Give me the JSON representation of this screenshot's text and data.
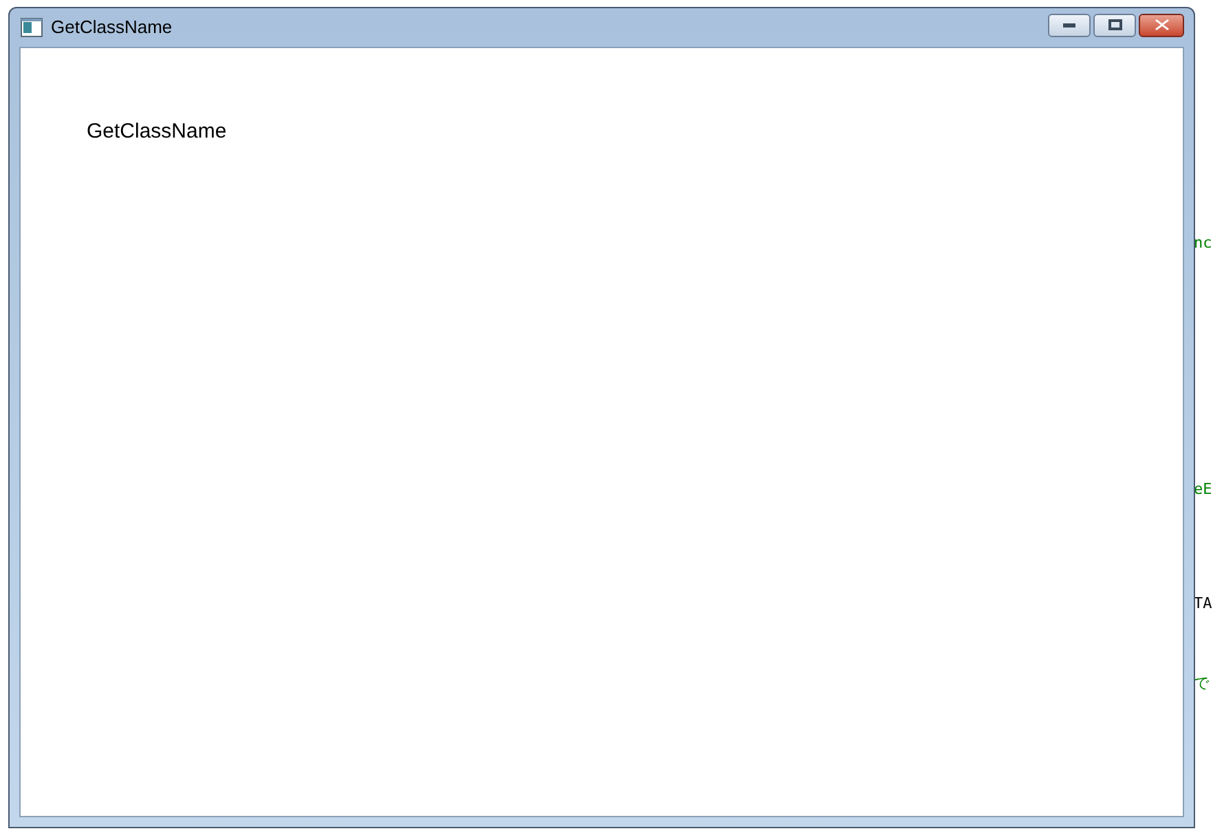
{
  "background_editor": {
    "fragments": [
      {
        "text": "nc",
        "kind": "comment"
      },
      {
        "text": "eE",
        "kind": "comment"
      },
      {
        "text": "TA",
        "kind": "code"
      },
      {
        "text": "で",
        "kind": "comment"
      }
    ]
  },
  "window": {
    "title": "GetClassName",
    "client_text": "GetClassName"
  }
}
